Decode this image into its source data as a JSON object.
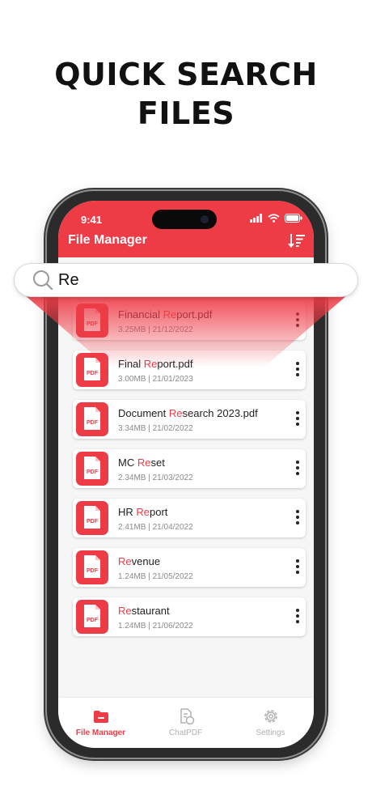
{
  "headline": {
    "line1": "QUICK SEARCH",
    "line2": "FILES"
  },
  "status_bar": {
    "time": "9:41"
  },
  "appbar": {
    "title": "File Manager"
  },
  "search": {
    "value": "Re",
    "icon": "search-icon"
  },
  "files": [
    {
      "prefix": "Financial ",
      "match": "Re",
      "suffix": "port.pdf",
      "size": "3.25MB",
      "date": "21/12/2022"
    },
    {
      "prefix": "Final ",
      "match": "Re",
      "suffix": "port.pdf",
      "size": "3.00MB",
      "date": "21/01/2023"
    },
    {
      "prefix": "Document ",
      "match": "Re",
      "suffix": "search 2023.pdf",
      "size": "3.34MB",
      "date": "21/02/2022"
    },
    {
      "prefix": "MC ",
      "match": "Re",
      "suffix": "set",
      "size": "2.34MB",
      "date": "21/03/2022"
    },
    {
      "prefix": "HR ",
      "match": "Re",
      "suffix": "port",
      "size": "2.41MB",
      "date": "21/04/2022"
    },
    {
      "prefix": "",
      "match": "Re",
      "suffix": "venue",
      "size": "1.24MB",
      "date": "21/05/2022"
    },
    {
      "prefix": "",
      "match": "Re",
      "suffix": "staurant",
      "size": "1.24MB",
      "date": "21/06/2022"
    }
  ],
  "file_thumb_label": "PDF",
  "meta_separator": " | ",
  "bottom_nav": {
    "file_manager": "File Manager",
    "chatpdf": "ChatPDF",
    "settings": "Settings"
  },
  "colors": {
    "accent": "#ee3c47",
    "muted": "#b0b0b0"
  }
}
